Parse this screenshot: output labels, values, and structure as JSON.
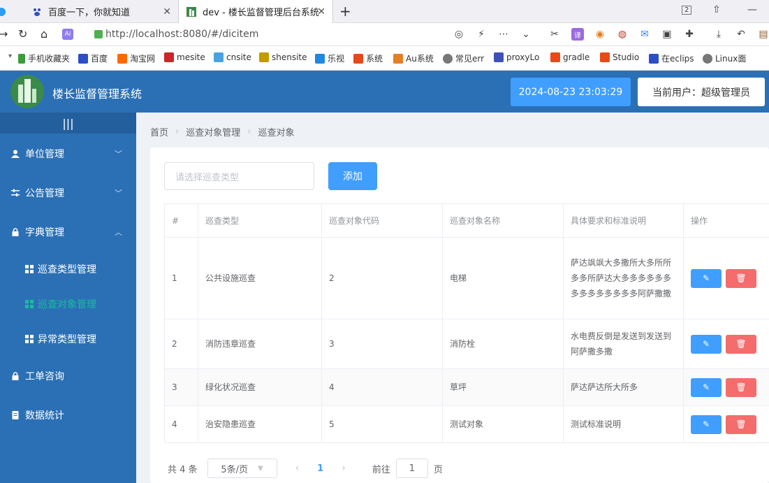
{
  "browser": {
    "tabs": [
      {
        "label": "百度一下，你就知道",
        "active": false
      },
      {
        "label": "dev - 楼长监督管理后台系统",
        "active": true
      }
    ],
    "tab_count": "2",
    "url": "http://localhost:8080/#/dicitem",
    "bookmarks": [
      {
        "label": "手机收藏夹",
        "color": "#3c9c3c"
      },
      {
        "label": "百度",
        "color": "#2d4ec8"
      },
      {
        "label": "淘宝网",
        "color": "#ff6a00"
      },
      {
        "label": "mesite",
        "color": "#c62828"
      },
      {
        "label": "cnsite",
        "color": "#4aa3df"
      },
      {
        "label": "shensite",
        "color": "#c49a00"
      },
      {
        "label": "乐视",
        "color": "#1e88e5"
      },
      {
        "label": "系统",
        "color": "#e64a19"
      },
      {
        "label": "Au系统",
        "color": "#e67e22"
      },
      {
        "label": "常见err",
        "color": "#777777"
      },
      {
        "label": "proxyLo",
        "color": "#3f51b5"
      },
      {
        "label": "gradle",
        "color": "#e64a19"
      },
      {
        "label": "Studio",
        "color": "#e64a19"
      },
      {
        "label": "在eclips",
        "color": "#2d4ec8"
      },
      {
        "label": "Linux面",
        "color": "#777777"
      }
    ]
  },
  "header": {
    "title": "楼长监督管理系统",
    "datetime": "2024-08-23 23:03:29",
    "current_user": "当前用户：超级管理员"
  },
  "sidebar": {
    "collapse_icon": "|||",
    "menus": [
      {
        "label": "单位管理",
        "icon": "user-icon"
      },
      {
        "label": "公告管理",
        "icon": "sliders-icon"
      },
      {
        "label": "字典管理",
        "icon": "lock-icon"
      },
      {
        "label": "工单咨询",
        "icon": "lock-icon"
      },
      {
        "label": "数据统计",
        "icon": "document-icon"
      }
    ],
    "submenus": [
      {
        "label": "巡查类型管理",
        "active": false
      },
      {
        "label": "巡查对象管理",
        "active": true
      },
      {
        "label": "异常类型管理",
        "active": false
      }
    ]
  },
  "breadcrumb": [
    "首页",
    "巡查对象管理",
    "巡查对象"
  ],
  "toolbar": {
    "select_placeholder": "请选择巡查类型",
    "add_label": "添加"
  },
  "table": {
    "headers": [
      "#",
      "巡查类型",
      "巡查对象代码",
      "巡查对象名称",
      "具体要求和标准说明",
      "操作"
    ],
    "rows": [
      {
        "index": "1",
        "type": "公共设施巡查",
        "code": "2",
        "name": "电梯",
        "desc": "萨达飒飒大多撒所大多所所多多所萨达大多多多多多多多多多多多多多多阿萨撒撒"
      },
      {
        "index": "2",
        "type": "消防违章巡查",
        "code": "3",
        "name": "消防栓",
        "desc": "水电费反倒是发送到发送到阿萨撒多撒"
      },
      {
        "index": "3",
        "type": "绿化状况巡查",
        "code": "4",
        "name": "草坪",
        "desc": "萨达萨达所大所多"
      },
      {
        "index": "4",
        "type": "治安隐患巡查",
        "code": "5",
        "name": "测试对象",
        "desc": "测试标准说明"
      }
    ]
  },
  "pagination": {
    "total": "共 4 条",
    "page_size": "5条/页",
    "current_page": "1",
    "goto_label": "前往",
    "goto_value": "1",
    "page_unit": "页"
  },
  "colors": {
    "header_bg": "#2b70b5",
    "primary": "#409eff",
    "danger": "#f56c6c",
    "active_menu": "#1abc9c"
  }
}
